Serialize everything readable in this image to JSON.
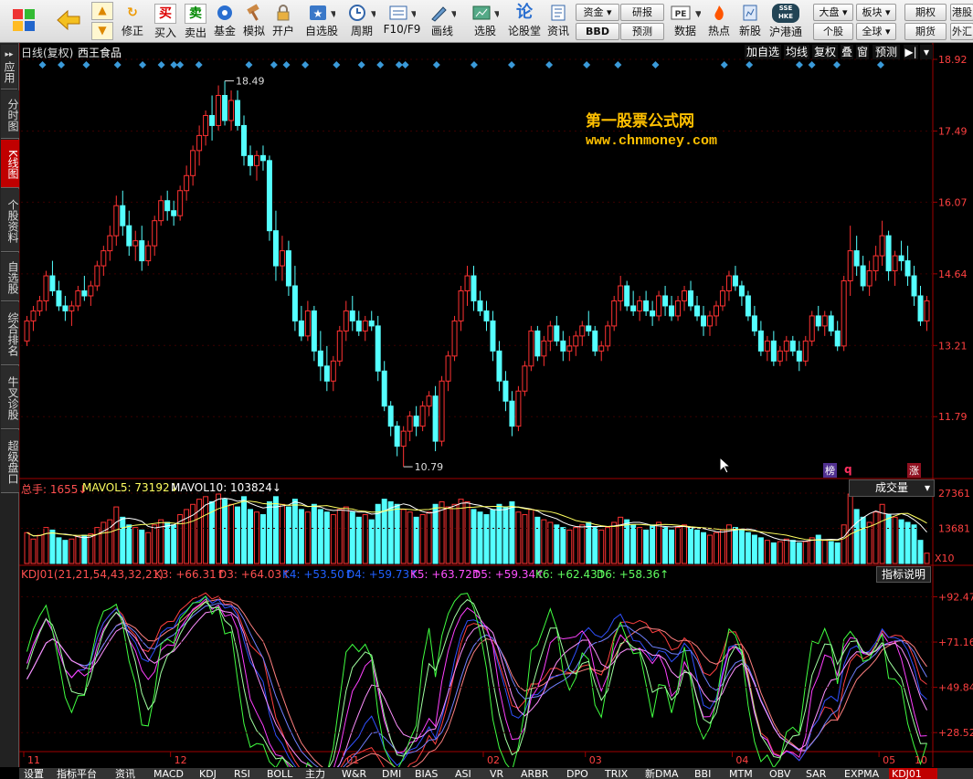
{
  "toolbar": {
    "items": [
      {
        "label": "",
        "icon": "windows-logo-icon"
      },
      {
        "label": "",
        "icon": "back-arrow-icon"
      },
      {
        "label": "修正",
        "icon": "refresh-icon"
      },
      {
        "label": "买入",
        "icon_text": "买"
      },
      {
        "label": "卖出",
        "icon_text": "卖"
      },
      {
        "label": "基金",
        "icon": "fund-icon"
      },
      {
        "label": "模拟",
        "icon": "hammer-icon"
      },
      {
        "label": "开户",
        "icon": "lock-icon"
      },
      {
        "label": "自选股",
        "icon": "star-icon"
      },
      {
        "label": "周期",
        "icon": "clock-icon"
      },
      {
        "label": "F10/F9",
        "icon": "f10-icon"
      },
      {
        "label": "画线",
        "icon": "pen-icon"
      },
      {
        "label": "选股",
        "icon": "select-stock-icon"
      },
      {
        "label": "论股堂",
        "icon_text": "论"
      },
      {
        "label": "资讯",
        "icon": "news-icon"
      },
      {
        "label": "数据",
        "icon_text": "PE"
      },
      {
        "label": "热点",
        "icon": "hot-icon"
      },
      {
        "label": "新股",
        "icon": "new-stock-icon"
      },
      {
        "label": "沪港通",
        "icon_text": "SSE HKE"
      }
    ],
    "small_buttons": [
      "资金",
      "BBD",
      "研报",
      "预测",
      "大盘",
      "板块",
      "期权",
      "港股",
      "个股",
      "全球",
      "期货",
      "外汇"
    ]
  },
  "sidebar": [
    "应用",
    "分时图",
    "K线图",
    "个股资料",
    "自选股",
    "综合排名",
    "牛叉诊股",
    "超级盘口"
  ],
  "header": {
    "period": "日线(复权)",
    "stock": "西王食品",
    "buttons": [
      "加自选",
      "均线",
      "复权",
      "叠",
      "窗",
      "预测"
    ]
  },
  "watermark": {
    "title": "第一股票公式网",
    "url": "www.chnmoney.com"
  },
  "price_axis": [
    "18.92",
    "17.49",
    "16.07",
    "14.64",
    "13.21",
    "11.79"
  ],
  "max_label": "18.49",
  "min_label": "10.79",
  "markers": {
    "bang": "榜",
    "q": "q",
    "zhang": "涨"
  },
  "volume": {
    "label_total": "总手: 1655↓",
    "label_ma5": "MAVOL5: 73192↓",
    "label_ma10": "MAVOL10: 103824↓",
    "selector": "成交量",
    "axis": [
      "27361",
      "13681"
    ],
    "unit": "X10"
  },
  "kdj": {
    "name": "KDJ01(21,21,54,43,32,21)",
    "K3": "K3: +66.31↑",
    "D3": "D3: +64.03↑",
    "K4": "K4: +53.50↑",
    "D4": "D4: +59.73↑",
    "K5": "K5: +63.72↑",
    "D5": "D5: +59.34↑",
    "K6": "K6: +62.43↑",
    "D6": "D6: +58.36↑",
    "help": "指标说明",
    "axis": [
      "+92.47",
      "+71.16",
      "+49.84",
      "+28.52"
    ]
  },
  "x_axis": [
    "11",
    "12",
    "01",
    "02",
    "03",
    "04",
    "05",
    "10"
  ],
  "tabs": [
    "设置",
    "指标平台",
    "资讯",
    "MACD",
    "KDJ",
    "RSI",
    "BOLL",
    "主力",
    "W&R",
    "DMI",
    "BIAS",
    "ASI",
    "VR",
    "ARBR",
    "DPO",
    "TRIX",
    "新DMA",
    "BBI",
    "MTM",
    "OBV",
    "SAR",
    "EXPMA",
    "KDJ01"
  ],
  "colors": {
    "up": "#ff3232",
    "down": "#54ffff",
    "accent": "#c00000",
    "watermark": "#ffc000"
  },
  "chart_data": {
    "type": "candlestick",
    "ylim": [
      10.5,
      18.92
    ],
    "ohlc": [
      [
        13.3,
        13.8,
        13.2,
        13.7
      ],
      [
        13.7,
        14.0,
        13.5,
        13.9
      ],
      [
        13.9,
        14.2,
        13.8,
        14.1
      ],
      [
        14.1,
        14.7,
        13.9,
        14.6
      ],
      [
        14.6,
        14.9,
        14.2,
        14.3
      ],
      [
        14.3,
        14.5,
        13.9,
        14.0
      ],
      [
        14.0,
        14.2,
        13.7,
        13.9
      ],
      [
        13.9,
        14.1,
        13.6,
        14.0
      ],
      [
        14.0,
        14.4,
        13.9,
        14.3
      ],
      [
        14.3,
        14.6,
        14.1,
        14.2
      ],
      [
        14.2,
        14.5,
        14.0,
        14.4
      ],
      [
        14.4,
        14.9,
        14.3,
        14.8
      ],
      [
        14.8,
        15.2,
        14.6,
        15.1
      ],
      [
        15.1,
        15.6,
        14.9,
        15.4
      ],
      [
        15.4,
        16.2,
        15.2,
        16.0
      ],
      [
        16.0,
        16.3,
        15.4,
        15.6
      ],
      [
        15.6,
        15.9,
        15.0,
        15.2
      ],
      [
        15.2,
        15.5,
        14.9,
        15.3
      ],
      [
        15.3,
        15.6,
        14.7,
        14.9
      ],
      [
        14.9,
        15.3,
        14.8,
        15.2
      ],
      [
        15.2,
        15.8,
        15.0,
        15.7
      ],
      [
        15.7,
        16.2,
        15.6,
        16.1
      ],
      [
        16.1,
        16.3,
        15.7,
        15.9
      ],
      [
        15.9,
        16.1,
        15.6,
        15.8
      ],
      [
        15.8,
        16.4,
        15.7,
        16.3
      ],
      [
        16.3,
        16.8,
        16.1,
        16.6
      ],
      [
        16.6,
        17.2,
        16.4,
        17.1
      ],
      [
        17.1,
        17.6,
        16.8,
        17.4
      ],
      [
        17.4,
        17.9,
        17.2,
        17.8
      ],
      [
        17.8,
        18.2,
        17.3,
        17.6
      ],
      [
        17.6,
        18.4,
        17.5,
        18.2
      ],
      [
        18.2,
        18.49,
        17.6,
        17.7
      ],
      [
        17.7,
        18.3,
        17.5,
        18.1
      ],
      [
        18.1,
        18.3,
        17.5,
        17.6
      ],
      [
        17.6,
        17.8,
        16.8,
        17.0
      ],
      [
        17.0,
        17.2,
        16.6,
        16.8
      ],
      [
        16.8,
        17.1,
        16.5,
        17.0
      ],
      [
        17.0,
        17.2,
        16.7,
        16.9
      ],
      [
        16.9,
        17.0,
        15.3,
        15.5
      ],
      [
        15.5,
        15.9,
        14.5,
        14.8
      ],
      [
        14.8,
        15.4,
        14.5,
        15.1
      ],
      [
        15.1,
        15.3,
        14.2,
        14.4
      ],
      [
        14.4,
        14.8,
        13.5,
        13.7
      ],
      [
        13.7,
        14.0,
        13.3,
        13.4
      ],
      [
        13.4,
        14.1,
        13.3,
        13.9
      ],
      [
        13.9,
        14.0,
        12.9,
        13.1
      ],
      [
        13.1,
        13.5,
        12.5,
        12.8
      ],
      [
        12.8,
        13.2,
        12.3,
        12.5
      ],
      [
        12.5,
        13.0,
        12.3,
        12.9
      ],
      [
        12.9,
        13.6,
        12.8,
        13.5
      ],
      [
        13.5,
        14.1,
        13.3,
        13.9
      ],
      [
        13.9,
        14.2,
        13.5,
        13.7
      ],
      [
        13.7,
        13.9,
        13.4,
        13.5
      ],
      [
        13.5,
        13.8,
        13.3,
        13.7
      ],
      [
        13.7,
        13.9,
        13.5,
        13.6
      ],
      [
        13.6,
        13.8,
        12.5,
        12.7
      ],
      [
        12.7,
        12.9,
        11.9,
        12.0
      ],
      [
        12.0,
        12.1,
        11.4,
        11.6
      ],
      [
        11.6,
        11.7,
        11.0,
        11.2
      ],
      [
        11.2,
        11.6,
        10.79,
        11.5
      ],
      [
        11.5,
        11.9,
        11.3,
        11.8
      ],
      [
        11.8,
        12.0,
        11.4,
        11.6
      ],
      [
        11.6,
        12.1,
        11.5,
        12.0
      ],
      [
        12.0,
        12.3,
        11.8,
        12.2
      ],
      [
        12.2,
        12.4,
        11.1,
        11.3
      ],
      [
        11.3,
        12.6,
        11.2,
        12.5
      ],
      [
        12.5,
        13.1,
        12.3,
        13.0
      ],
      [
        13.0,
        13.8,
        12.9,
        13.7
      ],
      [
        13.7,
        14.4,
        13.5,
        14.3
      ],
      [
        14.3,
        14.8,
        14.0,
        14.6
      ],
      [
        14.6,
        14.8,
        13.9,
        14.1
      ],
      [
        14.1,
        14.3,
        13.8,
        13.9
      ],
      [
        13.9,
        14.1,
        13.5,
        13.7
      ],
      [
        13.7,
        13.9,
        12.9,
        13.1
      ],
      [
        13.1,
        13.3,
        12.3,
        12.5
      ],
      [
        12.5,
        12.7,
        11.9,
        12.1
      ],
      [
        12.1,
        12.3,
        11.4,
        11.6
      ],
      [
        11.6,
        12.4,
        11.5,
        12.3
      ],
      [
        12.3,
        12.9,
        12.2,
        12.8
      ],
      [
        12.8,
        13.6,
        12.7,
        13.5
      ],
      [
        13.5,
        13.6,
        12.9,
        13.0
      ],
      [
        13.0,
        13.4,
        12.8,
        13.3
      ],
      [
        13.3,
        13.7,
        13.1,
        13.6
      ],
      [
        13.6,
        13.8,
        13.2,
        13.3
      ],
      [
        13.3,
        13.5,
        12.9,
        13.1
      ],
      [
        13.1,
        13.4,
        12.9,
        13.2
      ],
      [
        13.2,
        13.5,
        13.0,
        13.4
      ],
      [
        13.4,
        13.7,
        13.2,
        13.6
      ],
      [
        13.6,
        13.9,
        13.4,
        13.5
      ],
      [
        13.5,
        13.6,
        13.0,
        13.1
      ],
      [
        13.1,
        13.3,
        12.9,
        13.2
      ],
      [
        13.2,
        13.7,
        13.1,
        13.6
      ],
      [
        13.6,
        14.2,
        13.5,
        14.1
      ],
      [
        14.1,
        14.6,
        13.9,
        14.4
      ],
      [
        14.4,
        14.5,
        13.9,
        14.0
      ],
      [
        14.0,
        14.3,
        13.8,
        13.9
      ],
      [
        13.9,
        14.2,
        13.7,
        14.1
      ],
      [
        14.1,
        14.3,
        13.8,
        13.9
      ],
      [
        13.9,
        14.1,
        13.6,
        13.8
      ],
      [
        13.8,
        14.3,
        13.7,
        14.2
      ],
      [
        14.2,
        14.4,
        13.8,
        14.0
      ],
      [
        14.0,
        14.2,
        13.7,
        13.8
      ],
      [
        13.8,
        14.2,
        13.7,
        14.1
      ],
      [
        14.1,
        14.4,
        13.9,
        14.3
      ],
      [
        14.3,
        14.5,
        13.9,
        14.0
      ],
      [
        14.0,
        14.2,
        13.7,
        13.8
      ],
      [
        13.8,
        14.0,
        13.4,
        13.6
      ],
      [
        13.6,
        13.9,
        13.4,
        13.8
      ],
      [
        13.8,
        14.1,
        13.6,
        14.0
      ],
      [
        14.0,
        14.4,
        13.9,
        14.3
      ],
      [
        14.3,
        14.7,
        14.1,
        14.6
      ],
      [
        14.6,
        14.8,
        14.3,
        14.4
      ],
      [
        14.4,
        14.5,
        14.0,
        14.2
      ],
      [
        14.2,
        14.3,
        13.7,
        13.8
      ],
      [
        13.8,
        14.0,
        13.4,
        13.5
      ],
      [
        13.5,
        13.7,
        13.0,
        13.1
      ],
      [
        13.1,
        13.4,
        12.9,
        13.3
      ],
      [
        13.3,
        13.5,
        12.8,
        12.9
      ],
      [
        12.9,
        13.2,
        12.8,
        13.1
      ],
      [
        13.1,
        13.4,
        12.9,
        13.3
      ],
      [
        13.3,
        13.4,
        13.0,
        13.1
      ],
      [
        13.1,
        13.3,
        12.7,
        12.9
      ],
      [
        12.9,
        13.4,
        12.8,
        13.3
      ],
      [
        13.3,
        13.9,
        13.2,
        13.8
      ],
      [
        13.8,
        14.0,
        13.5,
        13.6
      ],
      [
        13.6,
        13.9,
        13.4,
        13.8
      ],
      [
        13.8,
        13.9,
        13.4,
        13.5
      ],
      [
        13.5,
        13.7,
        13.1,
        13.2
      ],
      [
        13.2,
        14.6,
        13.1,
        14.5
      ],
      [
        14.5,
        15.6,
        14.2,
        15.1
      ],
      [
        15.1,
        15.4,
        14.6,
        14.8
      ],
      [
        14.8,
        15.0,
        14.3,
        14.4
      ],
      [
        14.4,
        14.9,
        14.2,
        14.7
      ],
      [
        14.7,
        15.2,
        14.5,
        15.0
      ],
      [
        15.0,
        15.7,
        14.8,
        15.4
      ],
      [
        15.4,
        15.5,
        14.5,
        14.7
      ],
      [
        14.7,
        15.1,
        14.4,
        15.0
      ],
      [
        15.0,
        15.3,
        14.7,
        14.9
      ],
      [
        14.9,
        15.2,
        14.4,
        14.6
      ],
      [
        14.6,
        14.8,
        14.0,
        14.2
      ],
      [
        14.2,
        14.4,
        13.6,
        13.7
      ],
      [
        13.7,
        14.2,
        13.5,
        14.1
      ]
    ],
    "volume": [
      120,
      95,
      110,
      140,
      130,
      100,
      90,
      95,
      105,
      110,
      115,
      140,
      160,
      170,
      220,
      180,
      150,
      140,
      130,
      120,
      150,
      170,
      160,
      150,
      190,
      210,
      230,
      250,
      260,
      240,
      270,
      250,
      230,
      220,
      260,
      210,
      200,
      190,
      240,
      260,
      230,
      220,
      250,
      210,
      200,
      230,
      210,
      200,
      190,
      210,
      220,
      200,
      180,
      190,
      170,
      230,
      250,
      240,
      230,
      210,
      200,
      180,
      190,
      200,
      230,
      240,
      220,
      230,
      250,
      240,
      210,
      200,
      190,
      210,
      230,
      220,
      240,
      200,
      190,
      210,
      180,
      170,
      160,
      150,
      140,
      130,
      140,
      150,
      160,
      140,
      130,
      140,
      160,
      180,
      170,
      150,
      140,
      130,
      150,
      160,
      140,
      130,
      140,
      150,
      140,
      130,
      120,
      110,
      120,
      130,
      150,
      140,
      130,
      120,
      110,
      100,
      90,
      80,
      85,
      95,
      90,
      80,
      85,
      100,
      110,
      90,
      85,
      80,
      150,
      270,
      210,
      180,
      160,
      200,
      230,
      190,
      180,
      170,
      160,
      150,
      90,
      40
    ],
    "volume_max": 27361
  }
}
